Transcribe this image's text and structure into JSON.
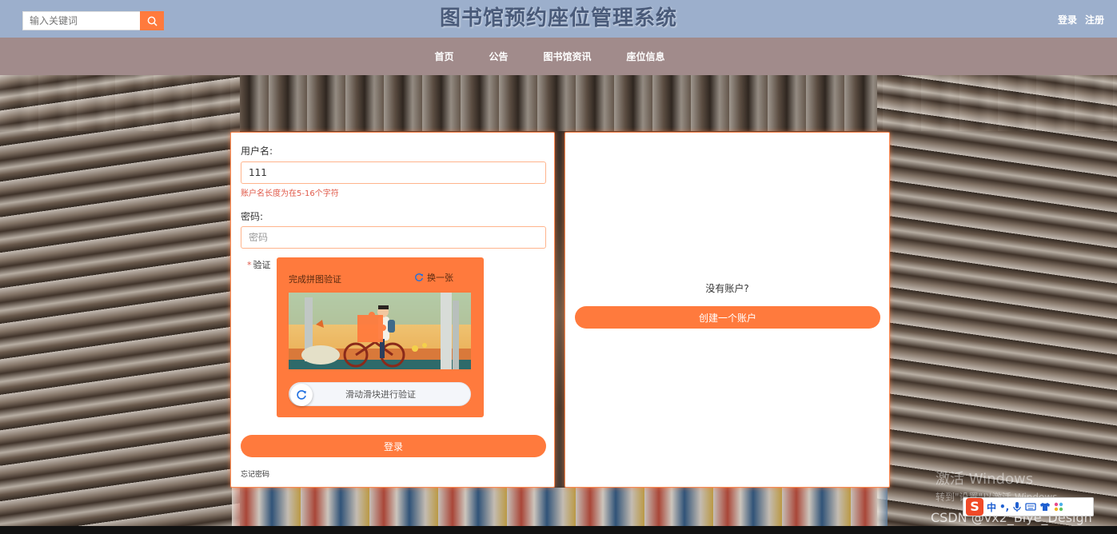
{
  "header": {
    "search_placeholder": "输入关键词",
    "title": "图书馆预约座位管理系统",
    "login_link": "登录",
    "register_link": "注册"
  },
  "nav": {
    "items": [
      "首页",
      "公告",
      "图书馆资讯",
      "座位信息"
    ]
  },
  "login": {
    "username_label": "用户名:",
    "username_value": "111",
    "username_error": "账户名长度为在5-16个字符",
    "password_label": "密码:",
    "password_placeholder": "密码",
    "verify_star": "*",
    "verify_label": "验证",
    "captcha_title": "完成拼图验证",
    "captcha_refresh": "换一张",
    "slider_text": "滑动滑块进行验证",
    "submit": "登录",
    "forgot": "忘记密码"
  },
  "register": {
    "no_account": "没有账户?",
    "create_button": "创建一个账户"
  },
  "overlay": {
    "watermark_line1": "激活 Windows",
    "watermark_line2": "转到\"设置\"以激活 Windows。",
    "csdn": "CSDN @vx2_Biye_Design",
    "ime_logo": "S",
    "ime_mode": "中",
    "ime_punct": "•,"
  },
  "colors": {
    "accent": "#ff7a3d",
    "topbar": "#9cafcc",
    "navbar": "#a18b8b",
    "error": "#e05a4a"
  },
  "icons": {
    "search": "search-icon",
    "refresh": "refresh-icon",
    "slider": "refresh-icon"
  }
}
